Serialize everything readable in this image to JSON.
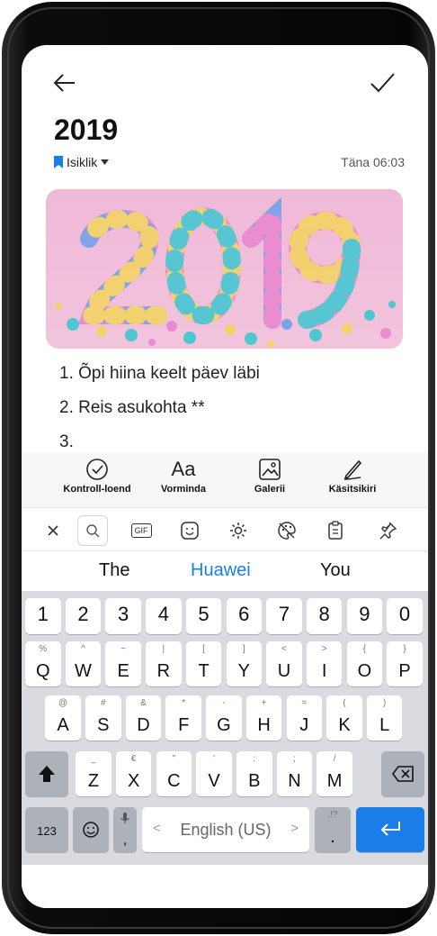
{
  "header": {
    "title": "2019",
    "category": "Isiklik",
    "date": "Täna 06:03"
  },
  "list": {
    "item1": "1. Õpi hiina keelt päev läbi",
    "item2": "2. Reis asukohta **",
    "item3": "3."
  },
  "tools": {
    "checklist": "Kontroll-loend",
    "format_icon_text": "Aa",
    "format": "Vorminda",
    "gallery": "Galerii",
    "handwriting": "Käsitsikiri"
  },
  "kb_toolbar": {
    "gif": "GIF"
  },
  "suggestions": {
    "left": "The",
    "middle": "Huawei",
    "right": "You"
  },
  "keyboard": {
    "numbers": [
      "1",
      "2",
      "3",
      "4",
      "5",
      "6",
      "7",
      "8",
      "9",
      "0"
    ],
    "row1": [
      [
        "%",
        "Q"
      ],
      [
        "^",
        "W"
      ],
      [
        "~",
        "E"
      ],
      [
        "|",
        "R"
      ],
      [
        "[",
        "T"
      ],
      [
        "]",
        "Y"
      ],
      [
        "<",
        "U"
      ],
      [
        ">",
        "I"
      ],
      [
        "{",
        "O"
      ],
      [
        "}",
        "P"
      ]
    ],
    "row2": [
      [
        "@",
        "A"
      ],
      [
        "#",
        "S"
      ],
      [
        "&",
        "D"
      ],
      [
        "*",
        "F"
      ],
      [
        "-",
        "G"
      ],
      [
        "+",
        "H"
      ],
      [
        "=",
        "J"
      ],
      [
        "(",
        "K"
      ],
      [
        ")",
        "L"
      ]
    ],
    "row3": [
      [
        "_",
        "Z"
      ],
      [
        "€",
        "X"
      ],
      [
        "\"",
        "C"
      ],
      [
        "'",
        "V"
      ],
      [
        ":",
        "B"
      ],
      [
        ";",
        "N"
      ],
      [
        "/",
        "M"
      ]
    ],
    "num_key": "123",
    "space": "English (US)",
    "space_left": "<",
    "space_right": ">",
    "punct_sub": ",!?",
    "punct": ".",
    "mic_sub": ",",
    "colors": {
      "accent": "#1a7ee8",
      "bg": "#d9dbe0"
    }
  }
}
